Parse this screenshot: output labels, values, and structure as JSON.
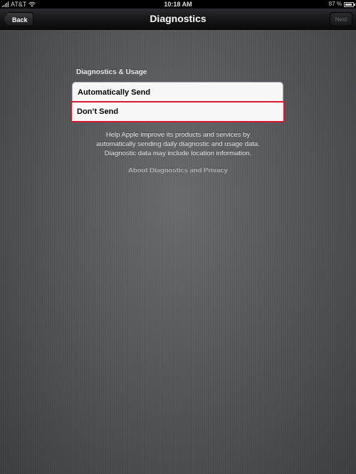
{
  "status_bar": {
    "carrier": "AT&T",
    "time": "10:18 AM",
    "battery_percent": "87 %",
    "battery_level": 0.87,
    "signal_icon": "signal-bars-icon",
    "wifi_icon": "wifi-icon",
    "battery_icon": "battery-icon"
  },
  "nav": {
    "title": "Diagnostics",
    "back_label": "Back",
    "next_label": "Next"
  },
  "section": {
    "header": "Diagnostics & Usage",
    "options": [
      {
        "label": "Automatically Send"
      },
      {
        "label": "Don’t Send",
        "selected": true
      }
    ],
    "footer_lines": [
      "Help Apple improve its products and services by",
      "automatically sending daily diagnostic and usage data.",
      "Diagnostic data may include location information."
    ],
    "link_label": "About Diagnostics and Privacy"
  },
  "colors": {
    "highlight": "#d7192b",
    "nav_background": "#151517",
    "background": "#56585c"
  }
}
